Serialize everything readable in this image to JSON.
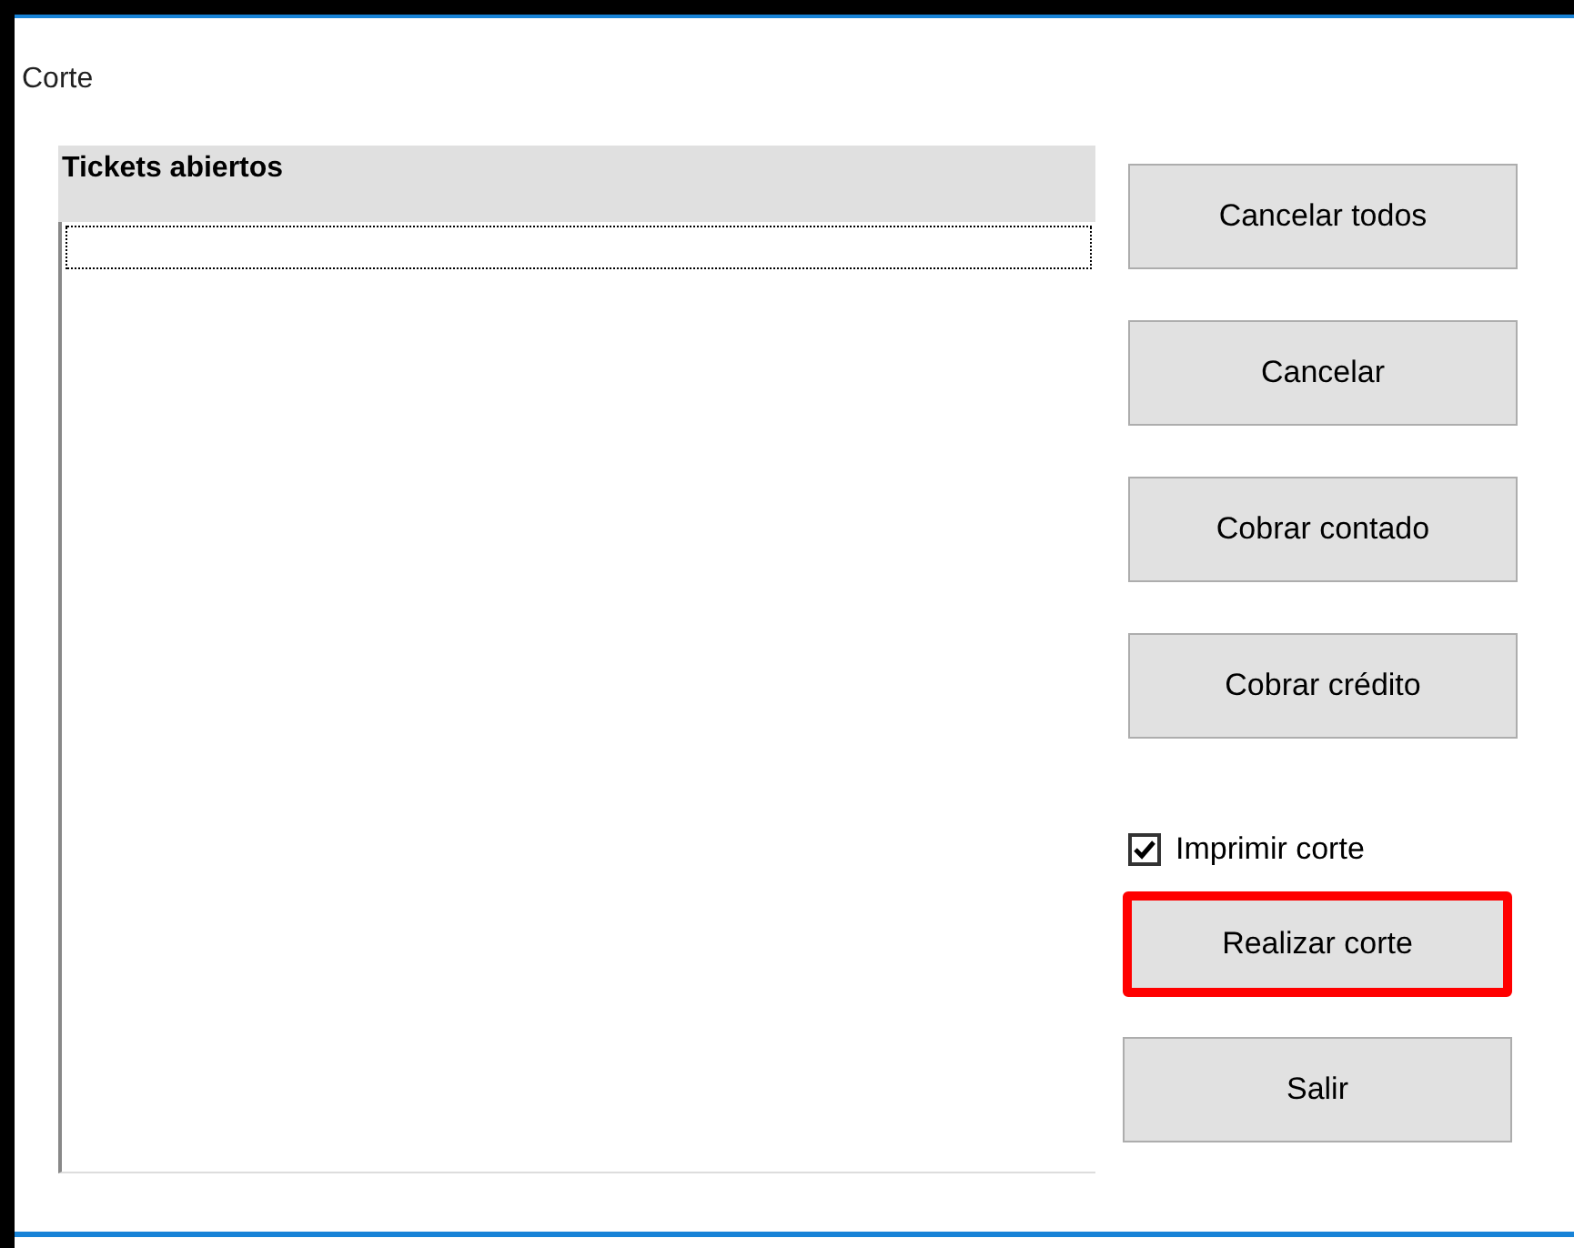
{
  "window": {
    "title": "Corte"
  },
  "list": {
    "header": "Tickets abiertos"
  },
  "buttons": [
    {
      "label": "Cancelar todos",
      "highlighted": false
    },
    {
      "label": "Cancelar",
      "highlighted": false
    },
    {
      "label": "Cobrar contado",
      "highlighted": false
    },
    {
      "label": "Cobrar crédito",
      "highlighted": false
    }
  ],
  "print_checkbox": {
    "label": "Imprimir corte",
    "checked": true
  },
  "bottom_buttons": [
    {
      "label": "Realizar corte",
      "highlighted": true
    },
    {
      "label": "Salir",
      "highlighted": false
    }
  ]
}
